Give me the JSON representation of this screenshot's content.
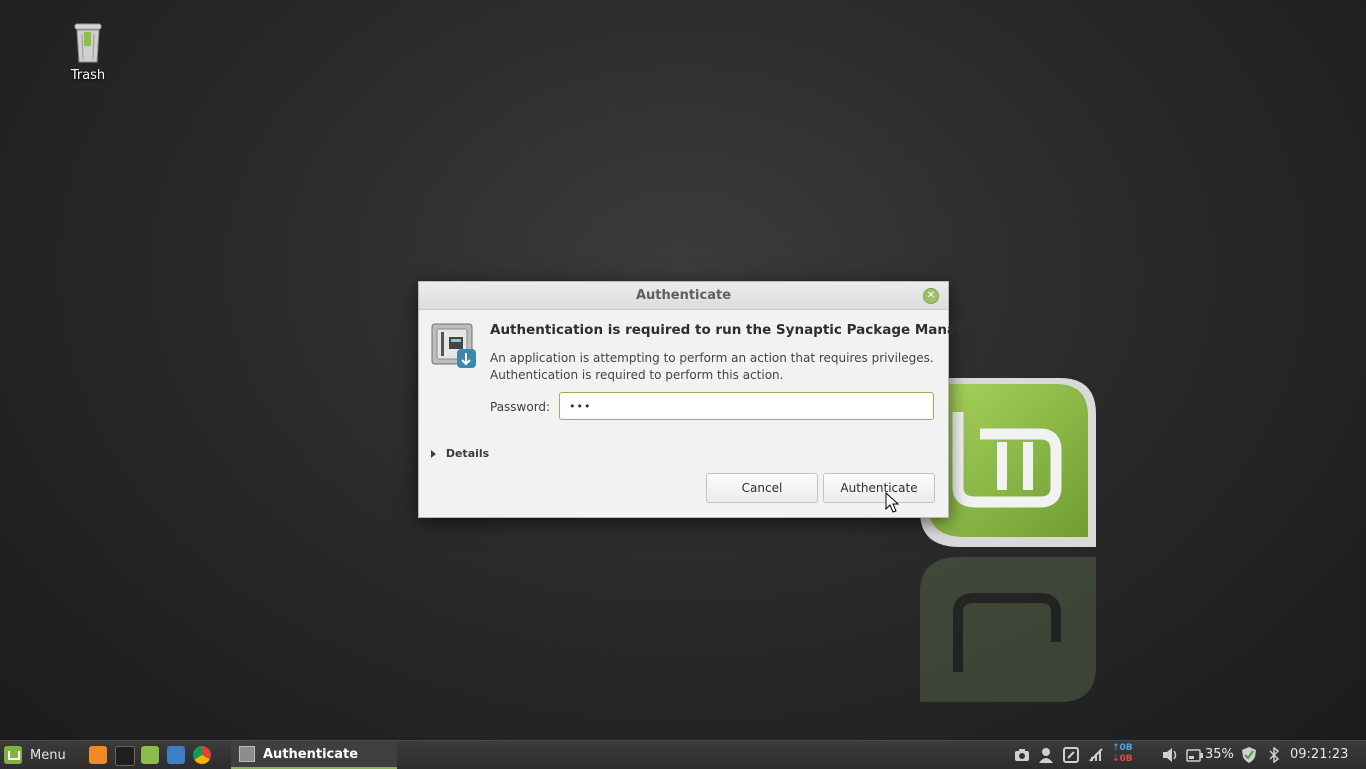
{
  "desktop": {
    "icons": [
      {
        "label": "Trash",
        "icon": "trash-icon"
      }
    ]
  },
  "dialog": {
    "title": "Authenticate",
    "heading": "Authentication is required to run the Synaptic Package Manager",
    "description_line1": "An application is attempting to perform an action that requires privileges.",
    "description_line2": "Authentication is required to perform this action.",
    "password_label": "Password:",
    "password_value": "•••",
    "details_label": "Details",
    "cancel_label": "Cancel",
    "authenticate_label": "Authenticate",
    "icon": "lock-safe-icon"
  },
  "taskbar": {
    "menu_label": "Menu",
    "launchers": [
      "firefox-icon",
      "terminal-icon",
      "files-icon",
      "screenshot-icon",
      "chrome-icon"
    ],
    "window_button_label": "Authenticate",
    "tray": {
      "net_up": "0B",
      "net_down": "0B",
      "battery": "35%",
      "clock": "09:21:23"
    }
  },
  "colors": {
    "accent": "#8bb34f",
    "mint_green": "#7fb241"
  }
}
